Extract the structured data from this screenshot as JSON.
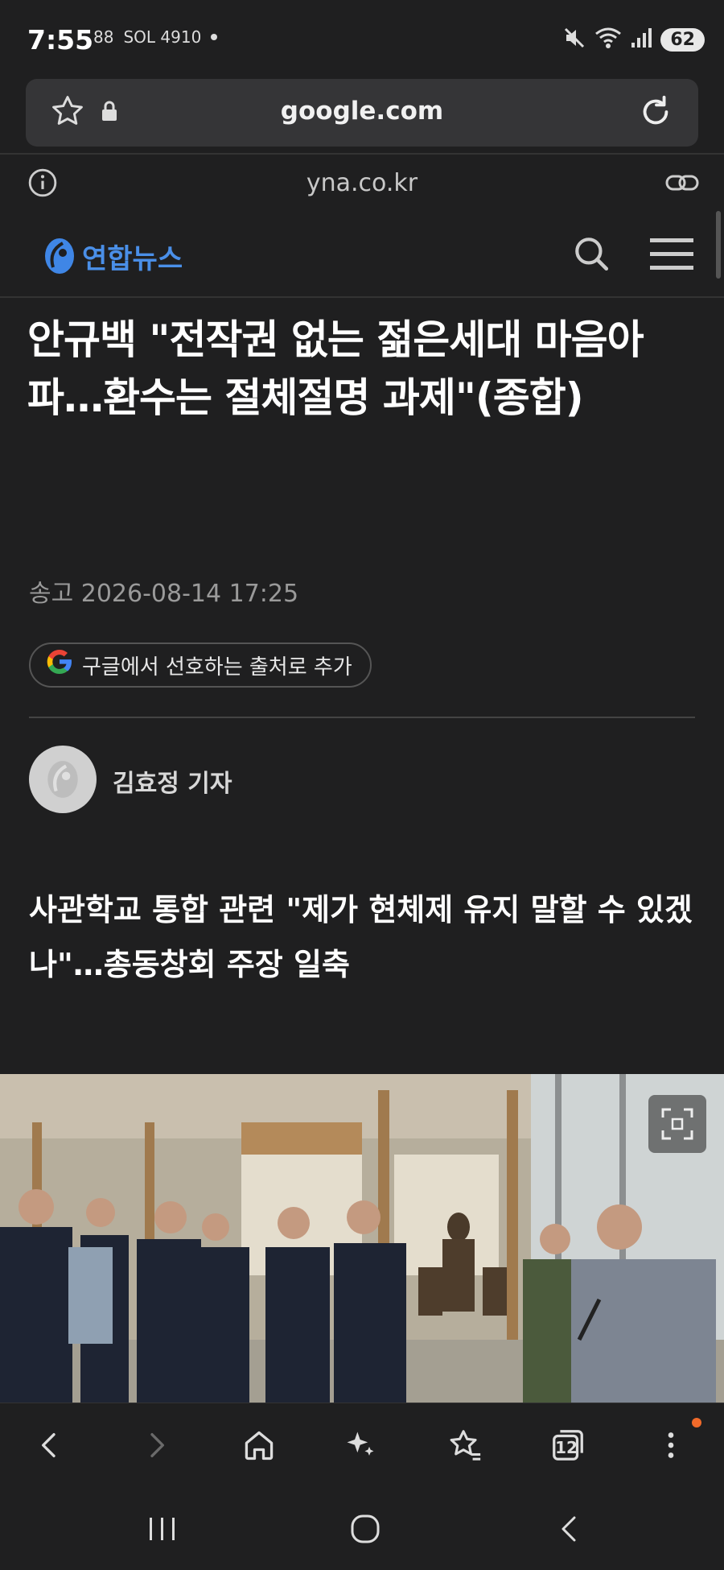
{
  "status_bar": {
    "time": "7:55",
    "left_icons": [
      "88",
      "SOL 4910"
    ],
    "battery": "62",
    "icons": [
      "mute-icon",
      "wifi-icon",
      "signal-icon"
    ]
  },
  "browser": {
    "url": "google.com",
    "site": "yna.co.kr",
    "icons": [
      "star-icon",
      "lock-icon",
      "reload-icon",
      "info-icon",
      "link-icon"
    ]
  },
  "site_header": {
    "logo_text": "연합뉴스",
    "icons": [
      "search-icon",
      "menu-icon"
    ]
  },
  "article": {
    "headline": "안규백 \"전작권 없는 젊은세대 마음아파…환수는 절체절명 과제\"(종합)",
    "date": "송고 2026-08-14 17:25",
    "preferred_source_label": "구글에서 선호하는 출처로 추가",
    "reporter": "김효정 기자",
    "subheadline": "사관학교 통합 관련 \"제가 현체제 유지 말할 수 있겠나\"…총동창회 주장 일축"
  },
  "toolbar": {
    "tab_count": "12",
    "icons": [
      "back-icon",
      "forward-icon",
      "home-icon",
      "sparkle-icon",
      "bookmarks-icon",
      "tabs-icon",
      "more-icon"
    ]
  },
  "colors": {
    "background": "#1f1f20",
    "accent_logo": "#4a8fe8",
    "notification": "#f06a2a"
  }
}
